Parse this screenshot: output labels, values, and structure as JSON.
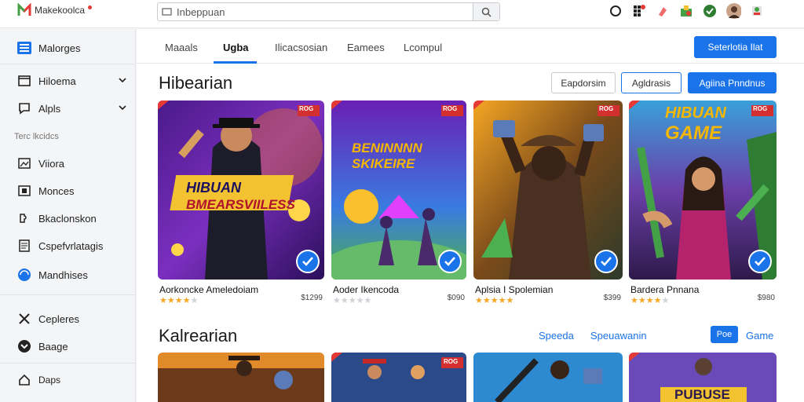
{
  "app": {
    "logo_text": "Makekoolca"
  },
  "search": {
    "value": "Inbeppuan",
    "placeholder": ""
  },
  "sidebar": {
    "items": [
      {
        "label": "Malorges",
        "icon": "list-icon"
      },
      {
        "label": "Hiloema",
        "icon": "window-icon"
      },
      {
        "label": "Alpls",
        "icon": "chat-icon"
      },
      {
        "label": "Viiora",
        "icon": "image-icon"
      },
      {
        "label": "Monces",
        "icon": "film-icon"
      },
      {
        "label": "Bkaclonskon",
        "icon": "puzzle-icon"
      },
      {
        "label": "Cspefvrlatagis",
        "icon": "document-icon"
      },
      {
        "label": "Mandhises",
        "icon": "globe-icon"
      },
      {
        "label": "Cepleres",
        "icon": "x-icon"
      },
      {
        "label": "Baage",
        "icon": "badge-icon"
      },
      {
        "label": "Daps",
        "icon": "home-icon"
      }
    ],
    "section_header": "Terc lkcidcs"
  },
  "tabs": [
    "Maaals",
    "Ugba",
    "Ilicacsosian",
    "Eamees",
    "Lcompul"
  ],
  "header_button": "Seterlotia Ilat",
  "section1": {
    "title": "Hibearian",
    "buttons": {
      "outline1": "Eapdorsim",
      "outline2": "Agldrasis",
      "primary": "Agiina Pnndnus"
    },
    "cards": [
      {
        "title": "Aorkoncke Ameledoiam",
        "price": "$1299",
        "rating": 4,
        "art_text_1": "HIBUAN",
        "art_text_2": "BMEARSVIILESS",
        "badge": "ROG"
      },
      {
        "title": "Aoder Ikencoda",
        "price": "$090",
        "rating": 0,
        "art_text_1": "BENINNNN",
        "art_text_2": "SKIKEIRE",
        "badge": "ROG"
      },
      {
        "title": "Aplsia I Spolemian",
        "price": "$399",
        "rating": 5,
        "art_text_1": "",
        "art_text_2": "",
        "badge": "ROG"
      },
      {
        "title": "Bardera Pnnana",
        "price": "$980",
        "rating": 4,
        "art_text_1": "HIBUAN",
        "art_text_2": "GAME",
        "badge": "ROG"
      }
    ]
  },
  "section2": {
    "title": "Kalrearian",
    "links": {
      "link1": "Speeda",
      "link2": "Speuawanin"
    },
    "pill": "Poe",
    "pill_link": "Game",
    "cards": [
      {
        "badge": ""
      },
      {
        "badge": "ROG"
      },
      {
        "badge": ""
      },
      {
        "art_text_1": "PUBUSE",
        "badge": ""
      }
    ]
  },
  "colors": {
    "accent": "#1a73e8",
    "star": "#f5a623"
  }
}
